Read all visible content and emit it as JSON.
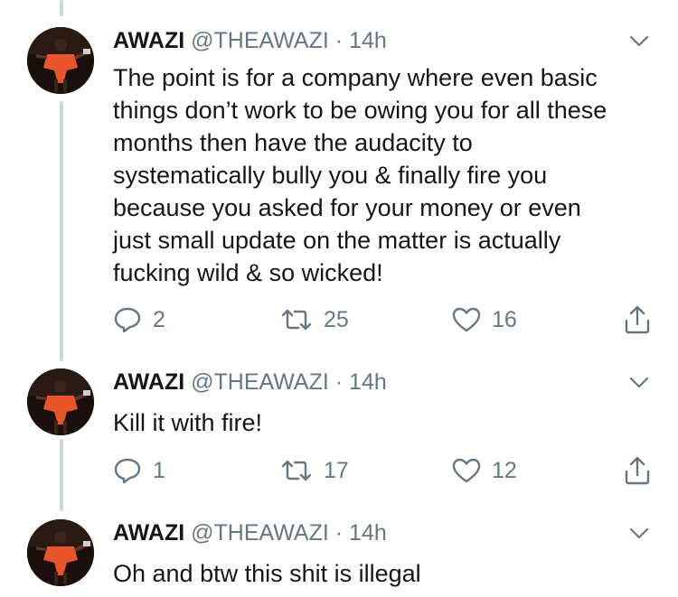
{
  "tweets": [
    {
      "name": "AWAZI",
      "handle": "@THEAWAZI",
      "separator": "·",
      "time": "14h",
      "text": "The point is for a company where even basic\nthings don’t work to be owing you for all these\nmonths then have the audacity to\nsystematically bully you & finally fire you\nbecause you asked for your money or even\njust small update on the matter is actually\nfucking wild & so wicked!",
      "replies": "2",
      "retweets": "25",
      "likes": "16"
    },
    {
      "name": "AWAZI",
      "handle": "@THEAWAZI",
      "separator": "·",
      "time": "14h",
      "text": "Kill it with fire!",
      "replies": "1",
      "retweets": "17",
      "likes": "12"
    },
    {
      "name": "AWAZI",
      "handle": "@THEAWAZI",
      "separator": "·",
      "time": "14h",
      "text": "Oh and btw this shit is illegal"
    }
  ],
  "colors": {
    "text": "#14171a",
    "muted": "#657786",
    "thread_line": "#ccd6dd",
    "avatar_accent": "#e8552a"
  }
}
